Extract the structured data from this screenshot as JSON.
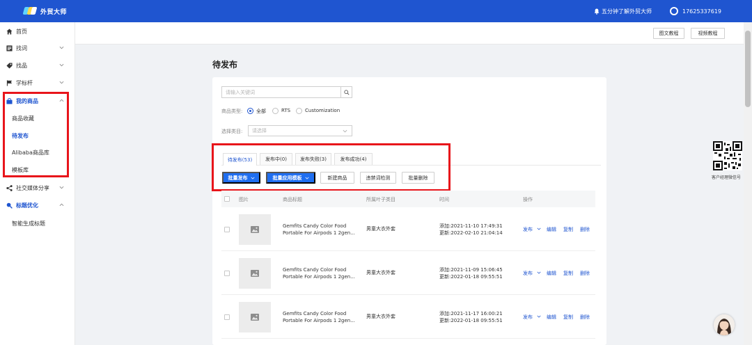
{
  "topbar": {
    "brand": "外贸大师",
    "notice": "五分钟了解外贸大师",
    "phone": "17625337619"
  },
  "sidebar": {
    "items": [
      {
        "label": "首页",
        "icon": "home-icon"
      },
      {
        "label": "找词",
        "icon": "keyword-icon"
      },
      {
        "label": "找品",
        "icon": "product-icon"
      },
      {
        "label": "学标杆",
        "icon": "flag-icon"
      },
      {
        "label": "我的商品",
        "icon": "bag-icon"
      },
      {
        "label": "社交媒体分享",
        "icon": "share-icon"
      },
      {
        "label": "标题优化",
        "icon": "search-icon"
      }
    ],
    "my_products_sub": [
      "商品收藏",
      "待发布",
      "Alibaba商品库",
      "模板库"
    ],
    "title_opt_sub": [
      "智能生成标题"
    ]
  },
  "subheader": {
    "btn_text_tutorial": "图文教程",
    "btn_video_tutorial": "视频教程"
  },
  "page": {
    "title": "待发布"
  },
  "filters": {
    "search_placeholder": "请输入关键词",
    "product_type_label": "商品类型:",
    "types": [
      "全部",
      "RTS",
      "Customization"
    ],
    "category_label": "选择类目:",
    "category_placeholder": "请选择"
  },
  "tabs": [
    "待发布(53)",
    "发布中(0)",
    "发布失败(3)",
    "发布成功(4)"
  ],
  "toolbar": {
    "batch_publish": "批量发布",
    "batch_template": "批量应用模板",
    "new_product": "新建商品",
    "forbidden_check": "违禁词检测",
    "batch_delete": "批量删除"
  },
  "table": {
    "headers": [
      "图片",
      "商品标题",
      "所属叶子类目",
      "时间",
      "操作"
    ],
    "rows": [
      {
        "title_line1": "Gemfits Candy Color Food",
        "title_line2": "Portable For Airpods 1 2gen...",
        "category": "男童大衣外套",
        "added": "添加:2021-11-10 17:49:31",
        "updated": "更新:2022-02-10 21:04:14"
      },
      {
        "title_line1": "Gemfits Candy Color Food",
        "title_line2": "Portable For Airpods 1 2gen...",
        "category": "男童大衣外套",
        "added": "添加:2021-11-09 15:06:45",
        "updated": "更新:2022-01-18 09:55:51"
      },
      {
        "title_line1": "Gemfits Candy Color Food",
        "title_line2": "Portable For Airpods 1 2gen...",
        "category": "男童大衣外套",
        "added": "添加:2021-11-17 16:00:21",
        "updated": "更新:2022-01-18 09:55:51"
      }
    ],
    "actions": [
      "发布",
      "编辑",
      "复制",
      "删除"
    ]
  },
  "side_widget": {
    "qr_label": "客户经理微信号"
  },
  "colors": {
    "primary": "#1f55d0",
    "button_blue": "#1f6ef0",
    "highlight_red": "#e8151b"
  }
}
